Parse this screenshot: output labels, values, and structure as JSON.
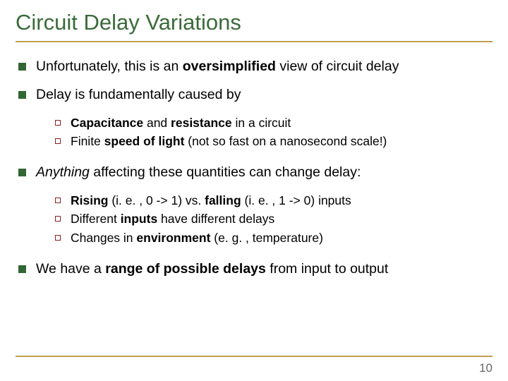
{
  "title": "Circuit Delay Variations",
  "bullets": [
    {
      "pre": "Unfortunately, this is an ",
      "bold1": "oversimplified",
      "post": " view of circuit delay"
    },
    {
      "text": "Delay is fundamentally caused by"
    },
    {
      "italic_bold": "Anything",
      "post": " affecting these quantities can change delay:"
    },
    {
      "pre": "We have a ",
      "bold1": "range of possible delays",
      "post": " from input to output"
    }
  ],
  "sub1": [
    {
      "b1": "Capacitance",
      "m1": " and ",
      "b2": "resistance",
      "m2": " in a circuit"
    },
    {
      "m0": "Finite ",
      "b1": "speed of light",
      "m1": " (not so fast on a nanosecond scale!)"
    }
  ],
  "sub2": [
    {
      "b1": "Rising",
      "m1": " (i. e. , 0 -> 1) vs. ",
      "b2": "falling",
      "m2": " (i. e. , 1 -> 0) inputs"
    },
    {
      "m0": "Different ",
      "b1": "inputs",
      "m1": " have different delays"
    },
    {
      "m0": "Changes in ",
      "b1": "environment",
      "m1": " (e. g. , temperature)"
    }
  ],
  "page": "10"
}
